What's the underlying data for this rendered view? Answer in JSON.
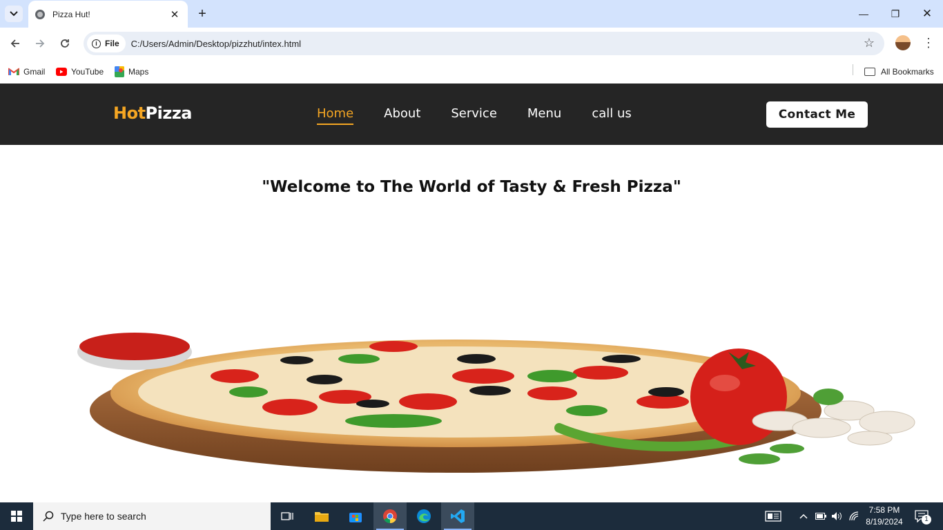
{
  "browser": {
    "tab_title": "Pizza Hut!",
    "chip_label": "File",
    "url": "C:/Users/Admin/Desktop/pizzhut/intex.html",
    "bookmarks": [
      {
        "label": "Gmail",
        "icon": "gmail-icon"
      },
      {
        "label": "YouTube",
        "icon": "youtube-icon"
      },
      {
        "label": "Maps",
        "icon": "maps-icon"
      }
    ],
    "all_bookmarks": "All Bookmarks"
  },
  "site": {
    "logo_hot": "Hot",
    "logo_pizza": "Pizza",
    "nav": [
      "Home",
      "About",
      "Service",
      "Menu",
      "call us"
    ],
    "active_nav": "Home",
    "contact_label": "Contact Me",
    "hero_title": "\"Welcome to The World of Tasty & Fresh Pizza\"",
    "colors": {
      "accent": "#f5a623",
      "nav_bg": "#252525"
    }
  },
  "taskbar": {
    "search_placeholder": "Type here to search",
    "time": "7:58 PM",
    "date": "8/19/2024",
    "notification_count": "1"
  }
}
